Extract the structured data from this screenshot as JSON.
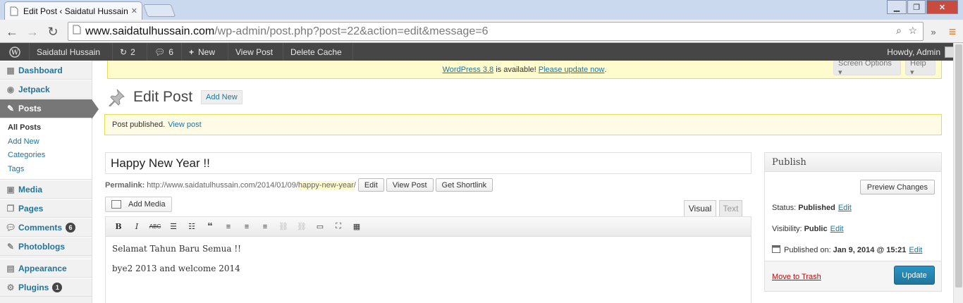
{
  "browser": {
    "tab_title": "Edit Post ‹ Saidatul Hussain",
    "url_prefix": "www.saidatulhussain.com",
    "url_path": "/wp-admin/post.php?post=22&action=edit&message=6"
  },
  "adminbar": {
    "site_name": "Saidatul Hussain",
    "updates_count": "2",
    "comments_count": "6",
    "new_label": "New",
    "view_post": "View Post",
    "delete_cache": "Delete Cache",
    "howdy": "Howdy, Admin"
  },
  "sidebar": {
    "dashboard": "Dashboard",
    "jetpack": "Jetpack",
    "posts": "Posts",
    "posts_sub": [
      "All Posts",
      "Add New",
      "Categories",
      "Tags"
    ],
    "media": "Media",
    "pages": "Pages",
    "comments": "Comments",
    "comments_badge": "6",
    "photoblogs": "Photoblogs",
    "appearance": "Appearance",
    "plugins": "Plugins",
    "plugins_badge": "1"
  },
  "nag": {
    "version_link": "WordPress 3.8",
    "middle": " is available! ",
    "update_link": "Please update now",
    "end": "."
  },
  "screen_options": "Screen Options ▾",
  "help": "Help ▾",
  "page": {
    "title": "Edit Post",
    "add_new": "Add New"
  },
  "notice": {
    "text": "Post published.",
    "link": "View post"
  },
  "post": {
    "title": "Happy New Year !!",
    "permalink_label": "Permalink:",
    "permalink_base": "http://www.saidatulhussain.com/2014/01/09/",
    "permalink_slug": "happy-new-year",
    "permalink_end": "/",
    "edit_btn": "Edit",
    "view_btn": "View Post",
    "shortlink_btn": "Get Shortlink"
  },
  "editor": {
    "add_media": "Add Media",
    "tab_visual": "Visual",
    "tab_text": "Text",
    "paragraphs": [
      "Selamat Tahun Baru Semua !!",
      "bye2 2013 and welcome 2014"
    ]
  },
  "publish": {
    "heading": "Publish",
    "preview": "Preview Changes",
    "status_label": "Status:",
    "status_value": "Published",
    "visibility_label": "Visibility:",
    "visibility_value": "Public",
    "published_label": "Published on:",
    "published_value": "Jan 9, 2014 @ 15:21",
    "edit": "Edit",
    "trash": "Move to Trash",
    "update": "Update"
  },
  "colors": {
    "link": "#21759b",
    "adminbar": "#464646",
    "primary_button": "#21759b",
    "trash": "#bc0b0b"
  }
}
